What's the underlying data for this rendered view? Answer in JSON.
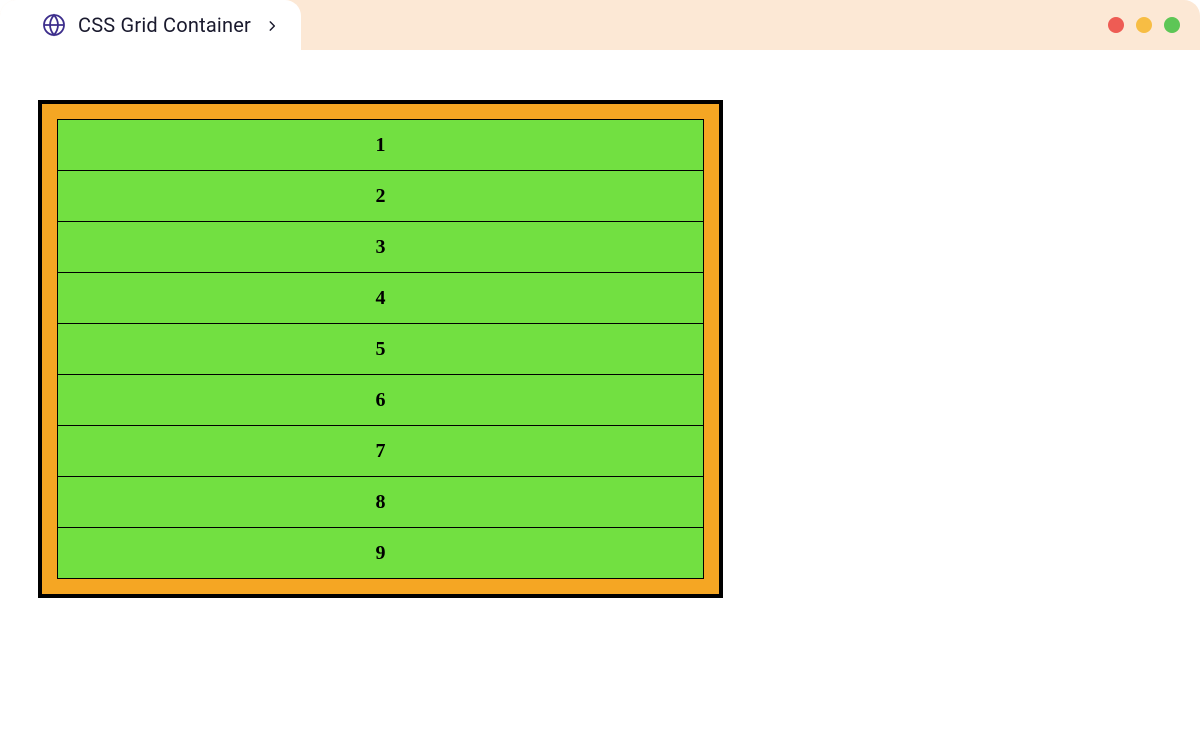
{
  "tab": {
    "title": "CSS Grid Container"
  },
  "grid": {
    "items": [
      {
        "label": "1"
      },
      {
        "label": "2"
      },
      {
        "label": "3"
      },
      {
        "label": "4"
      },
      {
        "label": "5"
      },
      {
        "label": "6"
      },
      {
        "label": "7"
      },
      {
        "label": "8"
      },
      {
        "label": "9"
      }
    ]
  },
  "colors": {
    "tab_bar_bg": "#fce8d5",
    "container_bg": "#f5a623",
    "cell_bg": "#72e041"
  }
}
